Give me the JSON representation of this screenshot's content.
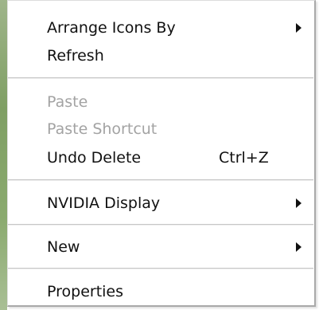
{
  "menu": {
    "items": [
      {
        "label": "Arrange Icons By",
        "has_submenu": true,
        "enabled": true
      },
      {
        "label": "Refresh",
        "has_submenu": false,
        "enabled": true
      },
      {
        "label": "Paste",
        "has_submenu": false,
        "enabled": false
      },
      {
        "label": "Paste Shortcut",
        "has_submenu": false,
        "enabled": false
      },
      {
        "label": "Undo Delete",
        "shortcut": "Ctrl+Z",
        "has_submenu": false,
        "enabled": true
      },
      {
        "label": "NVIDIA Display",
        "has_submenu": true,
        "enabled": true
      },
      {
        "label": "New",
        "has_submenu": true,
        "enabled": true
      },
      {
        "label": "Properties",
        "has_submenu": false,
        "enabled": true
      }
    ]
  },
  "colors": {
    "menu_background": "#ffffff",
    "text": "#111111",
    "disabled_text": "#a3a3a3",
    "separator": "#c7c7c7",
    "desktop_strip": "#7f9f64"
  }
}
